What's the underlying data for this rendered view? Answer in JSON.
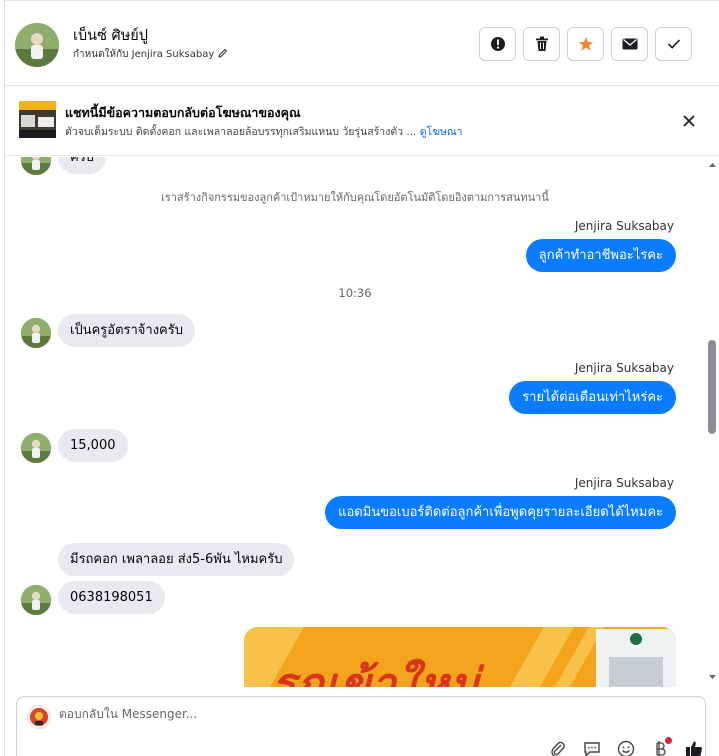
{
  "header": {
    "name": "เบ็นซ์ ศิษย์ปู",
    "assigned": "กำหนดให้กับ Jenjira Suksabay",
    "actions": [
      {
        "icon": "alert-icon"
      },
      {
        "icon": "trash-icon"
      },
      {
        "icon": "star-icon",
        "color": "#f5872a"
      },
      {
        "icon": "envelope-icon"
      },
      {
        "icon": "check-icon"
      }
    ]
  },
  "ad": {
    "title": "แชทนี้มีข้อความตอบกลับต่อโฆษณาของคุณ",
    "subtitle": "ตัวจบเต็มระบบ ติดตั้งคอก และเพลาลอยล้อบรรทุกเสริมแหนบ วัยรุ่นสร้างตัว ...",
    "link": "ดูโฆษณา"
  },
  "messages": {
    "partial_top": "ครับ",
    "system_note": "เราสร้างกิจกรรมของลูกค้าเป้าหมายให้กับคุณโดยอัตโนมัติโดยอิงตามการสนทนานี้",
    "sender1": "Jenjira Suksabay",
    "out1": "ลูกค้าทำอาชีพอะไรคะ",
    "time": "10:36",
    "in1": "เป็นครูอัตราจ้างครับ",
    "sender2": "Jenjira Suksabay",
    "out2": "รายได้ต่อเดือนเท่าไหร่คะ",
    "in2": "15,000",
    "sender3": "Jenjira Suksabay",
    "out3": "แอดมินขอเบอร์ติดต่อลูกค้าเพื่อพูดคุยรายละเอียดได้ไหมคะ",
    "in3": "มีรถคอก เพลาลอย ส่ง5-6พัน ไหมครับ",
    "in4": "0638198051",
    "image_text": "รถเข้าใหม่"
  },
  "composer": {
    "placeholder": "ตอบกลับใน Messenger..."
  },
  "colors": {
    "outgoing": "#0a7cff",
    "incoming": "#e9eaed",
    "link": "#0a64d8"
  }
}
